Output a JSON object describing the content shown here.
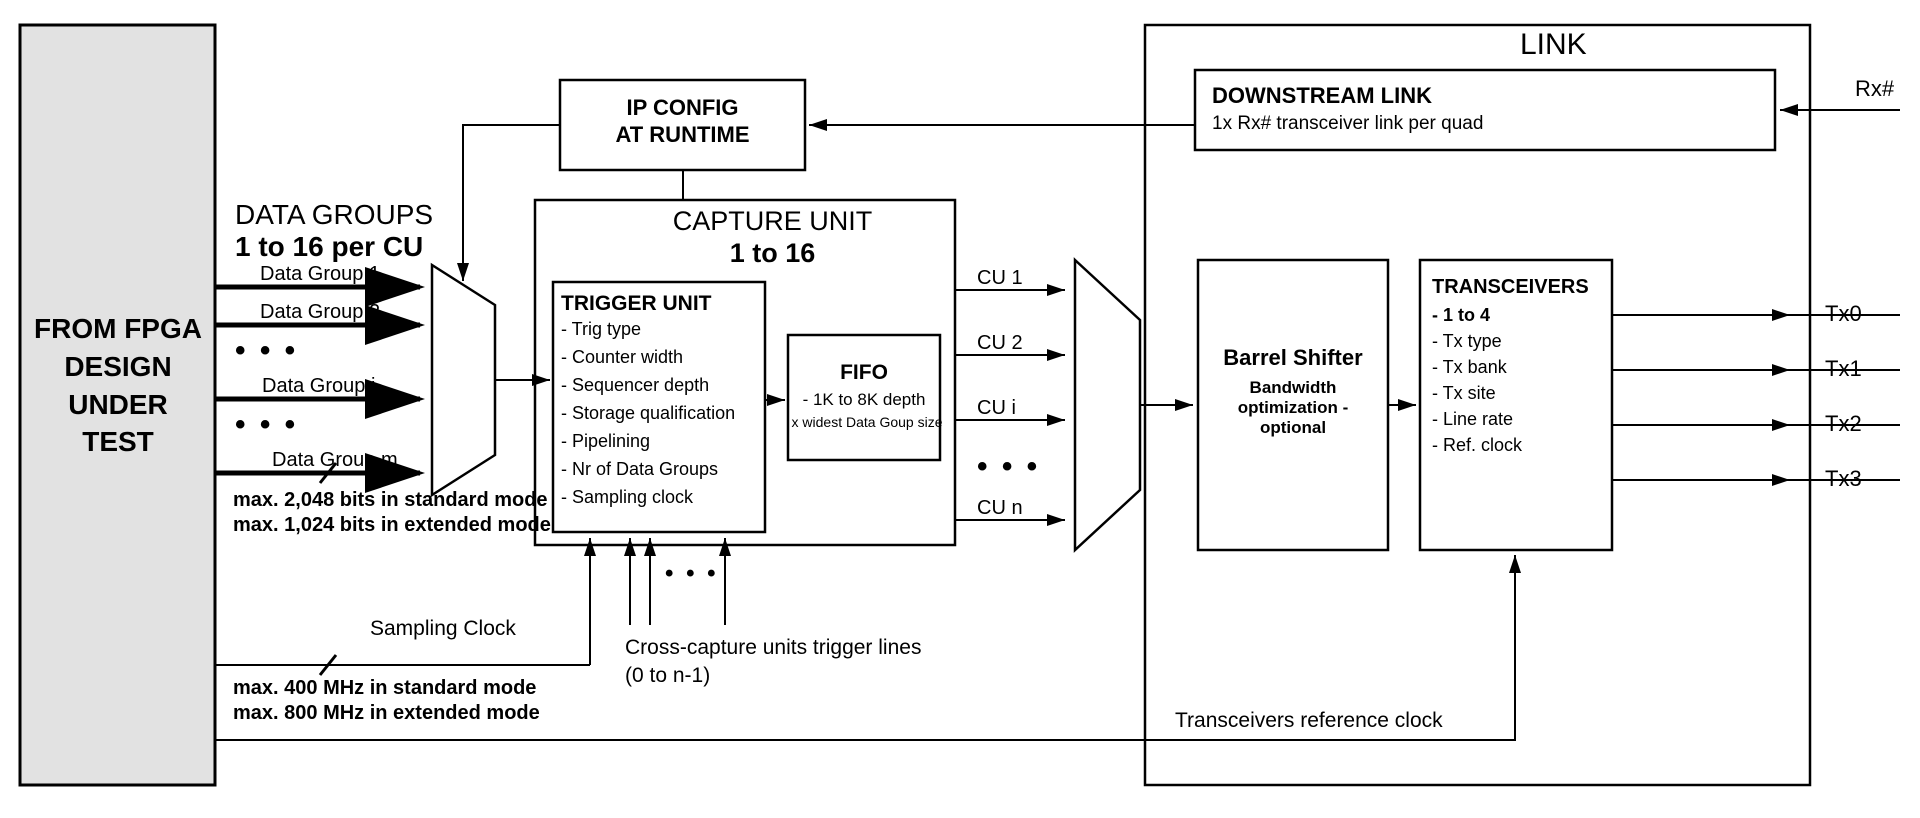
{
  "fpga": {
    "title": "FROM FPGA\nDESIGN\nUNDER TEST"
  },
  "datagroups": {
    "title_line1": "DATA GROUPS",
    "title_line2": "1 to 16 per CU",
    "items": [
      "Data Group 1",
      "Data Group 2",
      "Data Group j",
      "Data Group m"
    ],
    "ellipsis": "• • •",
    "note_line1": "max. 2,048 bits in standard mode",
    "note_line2": "max. 1,024 bits in extended mode"
  },
  "ipconfig": {
    "line1": "IP CONFIG",
    "line2": "AT RUNTIME"
  },
  "capture_unit": {
    "title_line1": "CAPTURE UNIT",
    "title_line2": "1 to 16"
  },
  "trigger_unit": {
    "title": "TRIGGER UNIT",
    "bullets": [
      "- Trig type",
      "- Counter width",
      "- Sequencer depth",
      "- Storage qualification",
      "- Pipelining",
      "- Nr of Data Groups",
      "- Sampling clock"
    ]
  },
  "fifo": {
    "title": "FIFO",
    "line1": "- 1K to 8K depth",
    "line2": "x widest Data Goup size"
  },
  "cu_outputs": {
    "items": [
      "CU 1",
      "CU 2",
      "CU i",
      "CU n"
    ],
    "ellipsis": "• • •"
  },
  "link": {
    "title": "LINK"
  },
  "downstream": {
    "title": "DOWNSTREAM LINK",
    "subtitle": "1x Rx# transceiver link per quad",
    "rx_label": "Rx#"
  },
  "barrel": {
    "title": "Barrel Shifter",
    "sub1": "Bandwidth",
    "sub2": "optimization -",
    "sub3": "optional"
  },
  "transceivers": {
    "title": "TRANSCEIVERS",
    "bullets": [
      "- 1 to 4",
      "- Tx type",
      "- Tx bank",
      "- Tx site",
      "- Line rate",
      "- Ref. clock"
    ],
    "tx": [
      "Tx0",
      "Tx1",
      "Tx2",
      "Tx3"
    ]
  },
  "clock": {
    "sampling_label": "Sampling Clock",
    "freq_line1": "max. 400 MHz in standard mode",
    "freq_line2": "max. 800 MHz in extended mode"
  },
  "cross_capture": {
    "line1": "Cross-capture units trigger lines",
    "line2": "(0 to n-1)",
    "ellipsis": "• • •"
  },
  "refclock": {
    "label": "Transceivers reference clock"
  }
}
